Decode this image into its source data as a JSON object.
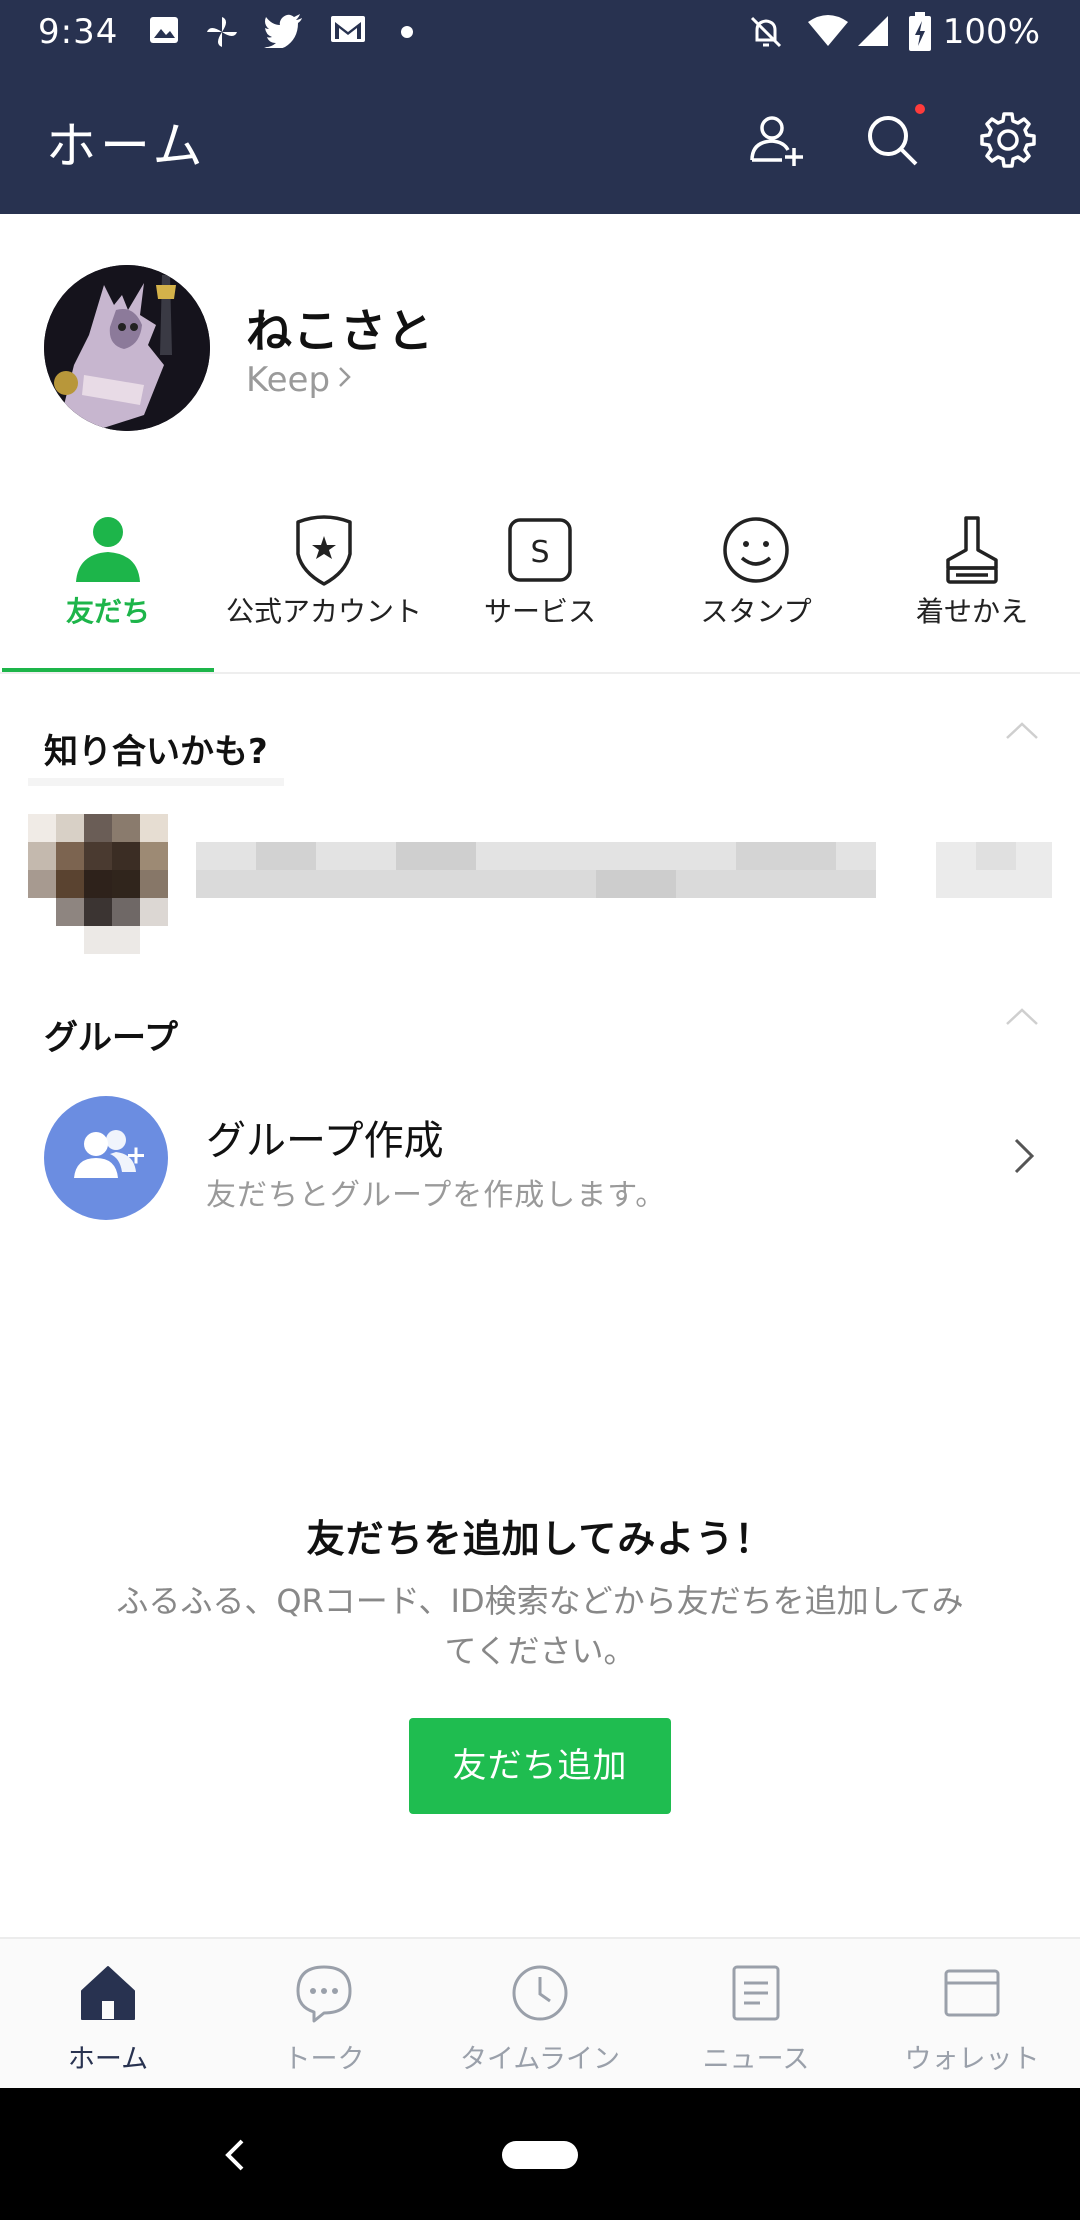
{
  "status_bar": {
    "time": "9:34",
    "battery": "100%",
    "left_icons": [
      "image-icon",
      "pinwheel-icon",
      "twitter-icon",
      "gmail-icon",
      "dot-icon"
    ],
    "right_icons": [
      "bell-off-icon",
      "wifi-icon",
      "signal-icon",
      "battery-icon"
    ]
  },
  "header": {
    "title": "ホーム",
    "actions": [
      "add-friend-icon",
      "search-icon",
      "settings-icon"
    ],
    "notification_dot_color": "#ff3b3b"
  },
  "profile": {
    "name": "ねこさと",
    "keep_label": "Keep"
  },
  "tabs": [
    {
      "label": "友だち",
      "icon": "person-icon",
      "active": true
    },
    {
      "label": "公式アカウント",
      "icon": "shield-star-icon",
      "active": false
    },
    {
      "label": "サービス",
      "icon": "service-s-icon",
      "active": false
    },
    {
      "label": "スタンプ",
      "icon": "smiley-icon",
      "active": false
    },
    {
      "label": "着せかえ",
      "icon": "brush-icon",
      "active": false
    }
  ],
  "suggestions": {
    "title": "知り合いかも?"
  },
  "groups": {
    "title": "グループ",
    "create_title": "グループ作成",
    "create_subtitle": "友だちとグループを作成します。"
  },
  "empty_state": {
    "title": "友だちを追加してみよう！",
    "description": "ふるふる、QRコード、ID検索などから友だちを追加してみてください。",
    "button_label": "友だち追加"
  },
  "bottom_nav": [
    {
      "label": "ホーム",
      "icon": "home-icon",
      "active": true
    },
    {
      "label": "トーク",
      "icon": "chat-icon",
      "active": false
    },
    {
      "label": "タイムライン",
      "icon": "clock-icon",
      "active": false
    },
    {
      "label": "ニュース",
      "icon": "news-icon",
      "active": false
    },
    {
      "label": "ウォレット",
      "icon": "wallet-icon",
      "active": false
    }
  ],
  "colors": {
    "header_bg": "#283250",
    "accent_green": "#1db54a",
    "group_icon_bg": "#6b8de1"
  }
}
